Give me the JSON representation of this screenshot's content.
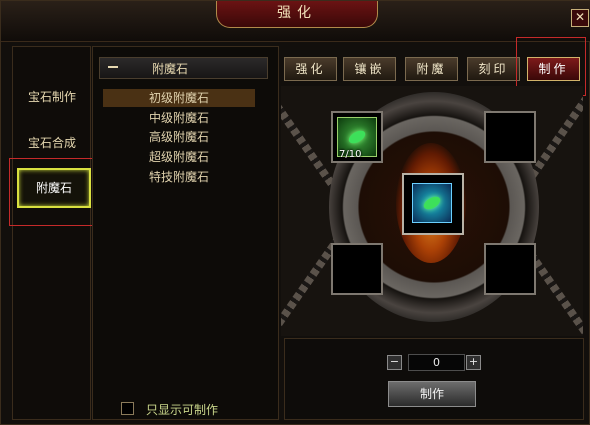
{
  "window": {
    "title": "强化",
    "close_label": "✕"
  },
  "left_nav": {
    "items": [
      {
        "label": "宝石制作"
      },
      {
        "label": "宝石合成"
      },
      {
        "label": "附魔石"
      }
    ],
    "active": "附魔石"
  },
  "list": {
    "header": "附魔石",
    "items": [
      {
        "label": "初级附魔石"
      },
      {
        "label": "中级附魔石"
      },
      {
        "label": "高级附魔石"
      },
      {
        "label": "超级附魔石"
      },
      {
        "label": "特技附魔石"
      }
    ],
    "selected": "初级附魔石",
    "filter_label": "只显示可制作"
  },
  "tabs": [
    {
      "label": "强化"
    },
    {
      "label": "镶嵌"
    },
    {
      "label": "附魔"
    },
    {
      "label": "刻印"
    },
    {
      "label": "制作"
    }
  ],
  "active_tab": "制作",
  "workspace": {
    "ingredient_count": "7/10",
    "ingredient_icon": "green-gem-icon",
    "result_icon": "green-gem-icon"
  },
  "controls": {
    "minus": "−",
    "quantity": "0",
    "plus": "+",
    "make_button": "制作"
  },
  "colors": {
    "accent_red": "#7e1a1a",
    "nav_highlight": "#d9e040",
    "selection": "#4a3114"
  }
}
